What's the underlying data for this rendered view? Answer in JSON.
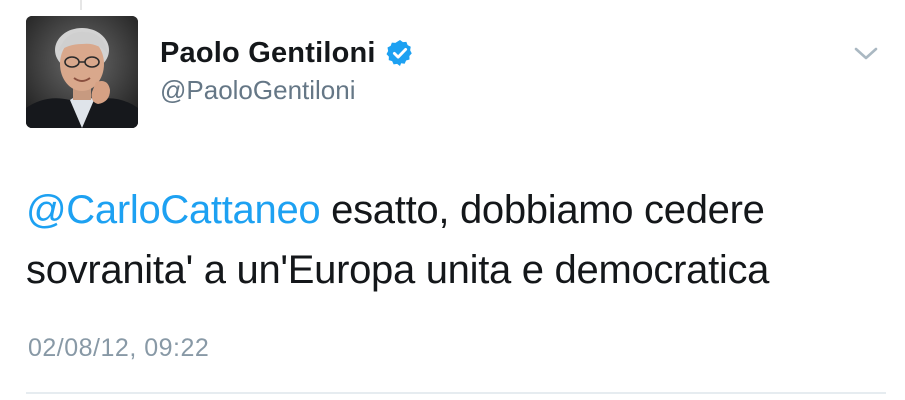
{
  "tweet": {
    "author": {
      "display_name": "Paolo Gentiloni",
      "handle": "@PaoloGentiloni",
      "verified": true,
      "avatar_icon": "profile-photo"
    },
    "mention": "@CarloCattaneo",
    "text_line1": " esatto, dobbiamo cedere",
    "text_line2": "sovranita' a un'Europa unita e democratica",
    "timestamp": "02/08/12, 09:22",
    "menu_icon": "chevron-down-icon"
  },
  "colors": {
    "link": "#1da1f2",
    "verified_badge": "#1da1f2",
    "text": "#14171a",
    "secondary": "#657786",
    "timestamp": "#8899a6"
  }
}
